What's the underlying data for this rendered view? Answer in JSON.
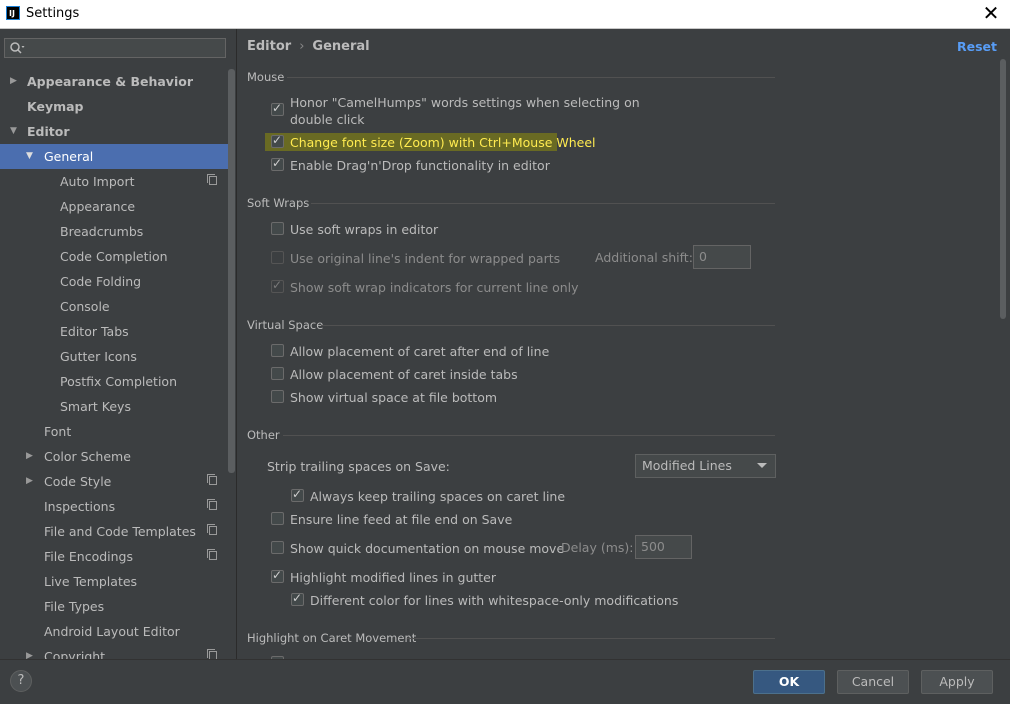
{
  "window": {
    "title": "Settings",
    "app_icon": "IJ"
  },
  "search": {
    "placeholder": ""
  },
  "sidebar": {
    "items": [
      {
        "label": "Appearance & Behavior",
        "bold": true
      },
      {
        "label": "Keymap",
        "bold": true
      },
      {
        "label": "Editor",
        "bold": true
      },
      {
        "label": "General",
        "selected": true
      },
      {
        "label": "Auto Import"
      },
      {
        "label": "Appearance"
      },
      {
        "label": "Breadcrumbs"
      },
      {
        "label": "Code Completion"
      },
      {
        "label": "Code Folding"
      },
      {
        "label": "Console"
      },
      {
        "label": "Editor Tabs"
      },
      {
        "label": "Gutter Icons"
      },
      {
        "label": "Postfix Completion"
      },
      {
        "label": "Smart Keys"
      },
      {
        "label": "Font"
      },
      {
        "label": "Color Scheme"
      },
      {
        "label": "Code Style"
      },
      {
        "label": "Inspections"
      },
      {
        "label": "File and Code Templates"
      },
      {
        "label": "File Encodings"
      },
      {
        "label": "Live Templates"
      },
      {
        "label": "File Types"
      },
      {
        "label": "Android Layout Editor"
      },
      {
        "label": "Copyright"
      }
    ]
  },
  "header": {
    "crumb_parent": "Editor",
    "crumb_sep": "›",
    "crumb_current": "General",
    "reset": "Reset"
  },
  "sections": {
    "mouse": {
      "title": "Mouse",
      "camelhumps_line1": "Honor \"CamelHumps\" words settings when selecting on",
      "camelhumps_line2": "double click",
      "zoom": "Change font size (Zoom) with Ctrl+Mouse Wheel",
      "dragdrop": "Enable Drag'n'Drop functionality in editor"
    },
    "soft_wraps": {
      "title": "Soft Wraps",
      "use_soft_wraps": "Use soft wraps in editor",
      "original_indent": "Use original line's indent for wrapped parts",
      "additional_shift_label": "Additional shift:",
      "additional_shift_value": "0",
      "show_indicators": "Show soft wrap indicators for current line only"
    },
    "virtual_space": {
      "title": "Virtual Space",
      "after_end": "Allow placement of caret after end of line",
      "inside_tabs": "Allow placement of caret inside tabs",
      "file_bottom": "Show virtual space at file bottom"
    },
    "other": {
      "title": "Other",
      "strip_label": "Strip trailing spaces on Save:",
      "strip_value": "Modified Lines",
      "keep_trailing": "Always keep trailing spaces on caret line",
      "ensure_lf": "Ensure line feed at file end on Save",
      "quick_doc": "Show quick documentation on mouse move",
      "delay_label": "Delay (ms):",
      "delay_value": "500",
      "highlight_modified": "Highlight modified lines in gutter",
      "diff_color": "Different color for lines with whitespace-only modifications"
    },
    "caret": {
      "title": "Highlight on Caret Movement"
    }
  },
  "footer": {
    "help": "?",
    "ok": "OK",
    "cancel": "Cancel",
    "apply": "Apply"
  },
  "colors": {
    "background": "#3c3f41",
    "selection": "#4b6eaf",
    "link": "#589df6",
    "primary_button": "#365880",
    "highlight": "#ffeb50"
  }
}
